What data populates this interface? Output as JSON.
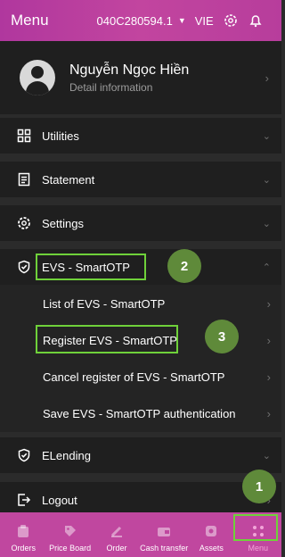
{
  "header": {
    "title": "Menu",
    "account": "040C280594.1",
    "language": "VIE"
  },
  "profile": {
    "name": "Nguyễn Ngọc Hiền",
    "subtitle": "Detail information"
  },
  "menu": {
    "utilities": "Utilities",
    "statement": "Statement",
    "settings": "Settings",
    "evs": "EVS - SmartOTP",
    "elending": "ELending",
    "logout": "Logout"
  },
  "evs_submenu": [
    {
      "label": "List of EVS - SmartOTP"
    },
    {
      "label": "Register EVS - SmartOTP"
    },
    {
      "label": "Cancel register of EVS - SmartOTP"
    },
    {
      "label": "Save EVS - SmartOTP authentication"
    }
  ],
  "annotations": {
    "badge1": "1",
    "badge2": "2",
    "badge3": "3"
  },
  "tabs": [
    {
      "label": "Orders",
      "icon": "orders-icon"
    },
    {
      "label": "Price Board",
      "icon": "price-board-icon"
    },
    {
      "label": "Order",
      "icon": "order-icon"
    },
    {
      "label": "Cash transfer",
      "icon": "cash-transfer-icon"
    },
    {
      "label": "Assets",
      "icon": "assets-icon"
    },
    {
      "label": "Menu",
      "icon": "menu-grid-icon",
      "active": true
    }
  ],
  "colors": {
    "header": "#b93f9e",
    "tabbar": "#c0479f",
    "highlight": "#6fd13a",
    "badge": "#5f8a3a",
    "background": "#1f1f1f"
  }
}
